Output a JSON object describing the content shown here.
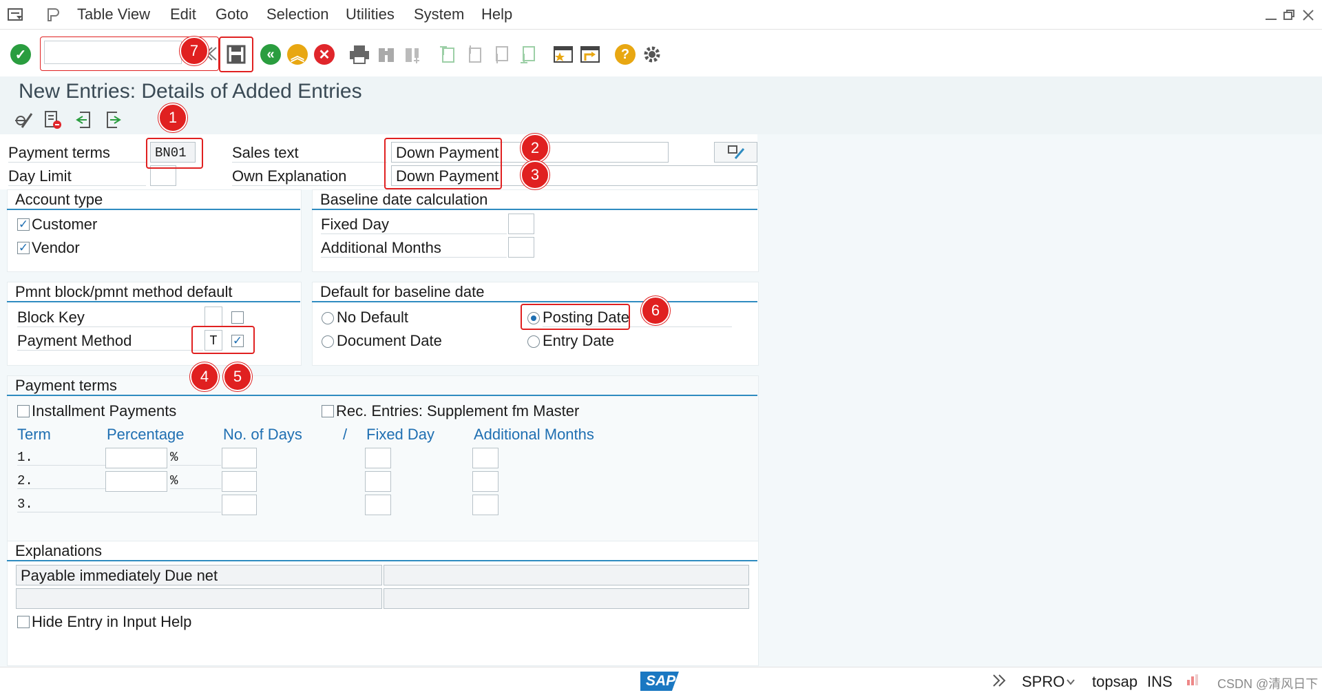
{
  "menubar": {
    "items": [
      "Table View",
      "Edit",
      "Goto",
      "Selection",
      "Utilities",
      "System",
      "Help"
    ]
  },
  "toolbar": {
    "command_value": "",
    "icons": [
      "enter-icon",
      "save-icon",
      "back-icon",
      "exit-icon",
      "cancel-icon",
      "print-icon",
      "find-icon",
      "find-next-icon",
      "first-page-icon",
      "previous-page-icon",
      "next-page-icon",
      "last-page-icon",
      "create-session-icon",
      "shortcut-icon",
      "help-icon",
      "settings-icon"
    ]
  },
  "title": "New Entries: Details of Added Entries",
  "header_fields": {
    "payment_terms_label": "Payment terms",
    "payment_terms_value": "BN01",
    "day_limit_label": "Day Limit",
    "day_limit_value": "",
    "sales_text_label": "Sales text",
    "sales_text_value": "Down Payment",
    "own_explanation_label": "Own Explanation",
    "own_explanation_value": "Down Payment"
  },
  "account_type": {
    "title": "Account type",
    "customer_label": "Customer",
    "customer_checked": "✓",
    "vendor_label": "Vendor",
    "vendor_checked": "✓"
  },
  "baseline_calc": {
    "title": "Baseline date calculation",
    "fixed_day_label": "Fixed Day",
    "fixed_day_value": "",
    "additional_months_label": "Additional Months",
    "additional_months_value": ""
  },
  "pmnt_block": {
    "title": "Pmnt block/pmnt method default",
    "block_key_label": "Block Key",
    "block_key_value": "",
    "payment_method_label": "Payment Method",
    "payment_method_value": "T",
    "payment_method_checked": "✓"
  },
  "default_baseline": {
    "title": "Default for baseline date",
    "no_default": "No Default",
    "document_date": "Document Date",
    "posting_date": "Posting Date",
    "entry_date": "Entry Date",
    "selected": "posting_date"
  },
  "payment_terms_group": {
    "title": "Payment terms",
    "installment_label": "Installment Payments",
    "rec_entries_label": "Rec. Entries: Supplement fm Master",
    "col_term": "Term",
    "col_percentage": "Percentage",
    "col_days": "No. of Days",
    "col_slash": "/",
    "col_fixed_day": "Fixed Day",
    "col_add_months": "Additional Months",
    "rows": [
      {
        "term": "1.",
        "pct_sign": "%"
      },
      {
        "term": "2.",
        "pct_sign": "%"
      },
      {
        "term": "3.",
        "pct_sign": ""
      }
    ]
  },
  "explanations": {
    "title": "Explanations",
    "line1": "Payable immediately Due net",
    "hide_entry_label": "Hide Entry in Input Help"
  },
  "markers": [
    "1",
    "2",
    "3",
    "4",
    "5",
    "6",
    "7"
  ],
  "statusbar": {
    "logo": "SAP",
    "transaction": "SPRO",
    "system": "topsap",
    "mode": "INS",
    "watermark": "CSDN @清风日下"
  },
  "colors": {
    "accent": "#2e8bc0",
    "marker": "#e02020",
    "check": "#1f6fb2"
  }
}
